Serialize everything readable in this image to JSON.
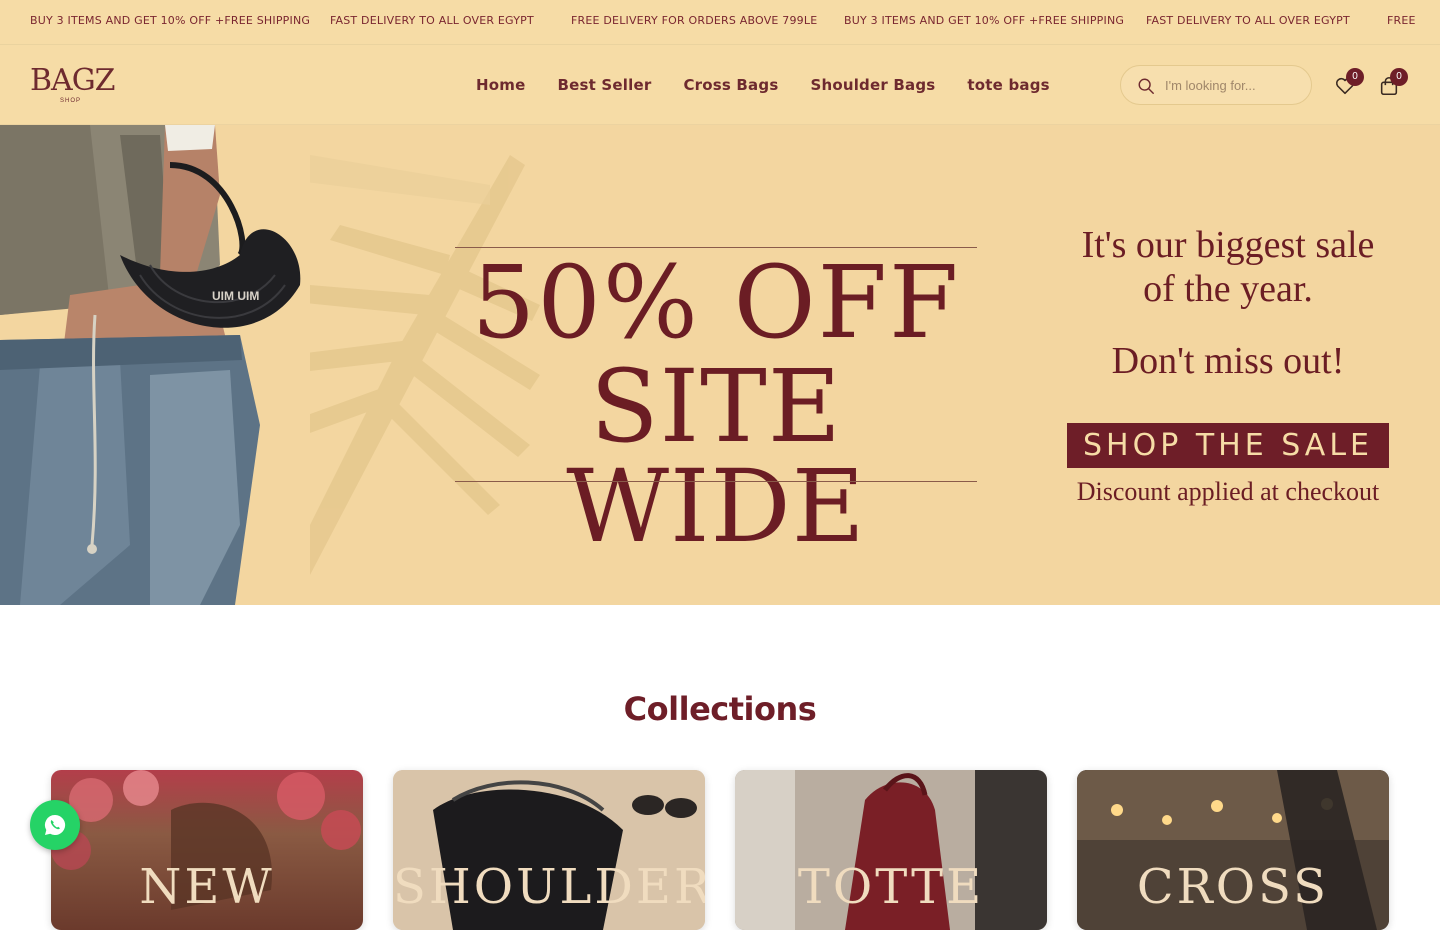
{
  "announcement": {
    "messages": [
      "BUY 3 ITEMS AND GET 10% OFF +FREE SHIPPING",
      "FAST DELIVERY TO ALL OVER EGYPT",
      "FREE DELIVERY FOR ORDERS ABOVE 799LE",
      "BUY 3 ITEMS AND GET 10% OFF +FREE SHIPPING",
      "FAST DELIVERY TO ALL OVER EGYPT",
      "FREE"
    ]
  },
  "header": {
    "logo": {
      "word": "BAGZ",
      "sub": "SHOP"
    },
    "nav": [
      "Home",
      "Best Seller",
      "Cross Bags",
      "Shoulder Bags",
      "tote bags"
    ],
    "search": {
      "placeholder": "I'm looking for..."
    },
    "wishlist_count": "0",
    "cart_count": "0"
  },
  "hero": {
    "headline_line1": "50% OFF",
    "headline_line2": "SITE WIDE",
    "side_line1": "It's our biggest sale of the year.",
    "side_line2": "Don't miss out!",
    "button": "SHOP THE SALE",
    "note": "Discount applied at checkout",
    "bag_label": "UIM UIM"
  },
  "collections": {
    "title": "Collections",
    "cards": [
      {
        "label": "NEW"
      },
      {
        "label": "SHOULDER"
      },
      {
        "label": "TOTTE"
      },
      {
        "label": "CROSS"
      }
    ]
  },
  "colors": {
    "brand": "#6e1e28",
    "cream": "#f6dca6",
    "whatsapp": "#25d366"
  }
}
